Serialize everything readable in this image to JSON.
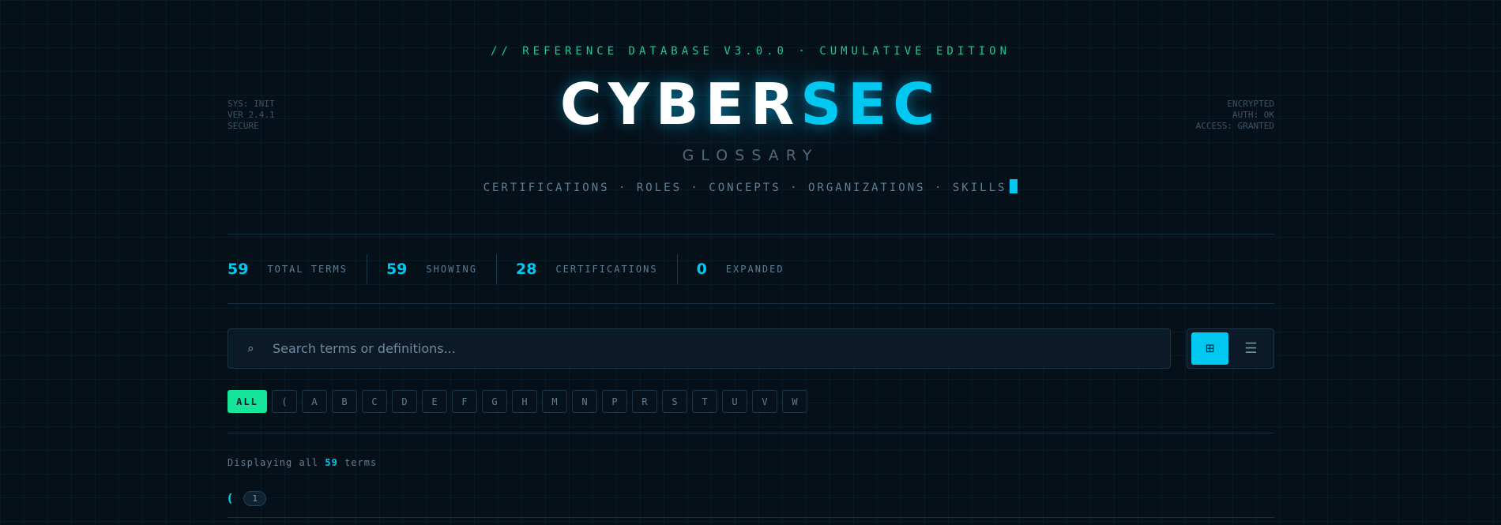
{
  "header": {
    "kicker": "// REFERENCE DATABASE V3.0.0 · CUMULATIVE EDITION",
    "title_part1": "CYBER",
    "title_part2": "SEC",
    "subtitle": "GLOSSARY",
    "tagline": "CERTIFICATIONS · ROLES · CONCEPTS · ORGANIZATIONS · SKILLS",
    "left_info": [
      "SYS: INIT",
      "VER 2.4.1",
      "SECURE"
    ],
    "right_info": [
      "ENCRYPTED",
      "AUTH: OK",
      "ACCESS: GRANTED"
    ]
  },
  "stats": [
    {
      "value": "59",
      "label": "TOTAL TERMS"
    },
    {
      "value": "59",
      "label": "SHOWING"
    },
    {
      "value": "28",
      "label": "CERTIFICATIONS"
    },
    {
      "value": "0",
      "label": "EXPANDED"
    }
  ],
  "search": {
    "placeholder": "Search terms or definitions...",
    "icon": "search-icon"
  },
  "view_toggle": {
    "grid_icon": "grid-icon",
    "list_icon": "list-icon",
    "active": "grid"
  },
  "letters": [
    "ALL",
    "(",
    "A",
    "B",
    "C",
    "D",
    "E",
    "F",
    "G",
    "H",
    "M",
    "N",
    "P",
    "R",
    "S",
    "T",
    "U",
    "V",
    "W"
  ],
  "active_letter": "ALL",
  "results": {
    "prefix": "Displaying all",
    "count": "59",
    "suffix": "terms"
  },
  "section": {
    "char": "(",
    "count": "1"
  },
  "colors": {
    "accent": "#00c8f0",
    "green": "#14e59a",
    "background": "#061019"
  }
}
